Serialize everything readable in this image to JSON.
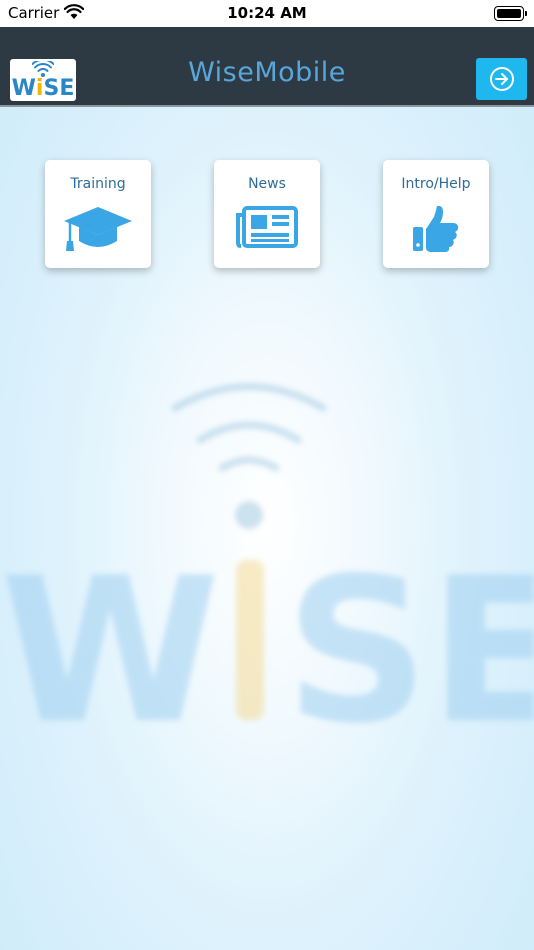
{
  "status_bar": {
    "carrier": "Carrier",
    "time": "10:24 AM"
  },
  "header": {
    "logo_text_part1": "W",
    "logo_text_accent": "i",
    "logo_text_part2": "SE",
    "title": "WiseMobile",
    "login_icon": "sign-in-icon"
  },
  "tiles": [
    {
      "label": "Training",
      "icon": "graduation-cap-icon"
    },
    {
      "label": "News",
      "icon": "newspaper-icon"
    },
    {
      "label": "Intro/Help",
      "icon": "thumbs-up-icon"
    }
  ],
  "watermark": {
    "text_part1": "W",
    "text_accent": "i",
    "text_part2": "SE"
  },
  "colors": {
    "header_bg": "#2d3a44",
    "title": "#58a6da",
    "accent_button": "#1eb8ef",
    "icon_blue": "#3aa6e6",
    "logo_accent": "#f4b400"
  }
}
